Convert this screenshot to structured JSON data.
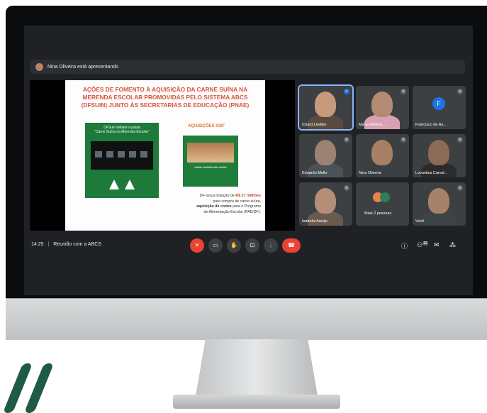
{
  "meeting": {
    "presenting_text": "Nina Oliveira está apresentando",
    "time": "14:25",
    "separator": "|",
    "title": "Reunião com a ABCS"
  },
  "slide": {
    "title_line1": "AÇÕES DE FOMENTO À AQUISIÇÃO DA CARNE SUÍNA NA",
    "title_line2": "MERENDA ESCOLAR PROMOVIDAS PELO SISTEMA ABCS",
    "title_line3": "(DFSUIN) JUNTO ÀS SECRETARIAS DE EDUCAÇÃO (PNAE)",
    "promo_caption_1": "DFSuin debate a pauta",
    "promo_caption_2": "“Carne Suína na Merenda Escolar”",
    "acq_title": "AQUISIÇÕES GDF",
    "text_1": "DF lança licitação de",
    "text_amount": "R$ 27 milhões",
    "text_2": "para compra de carne suína,",
    "text_bold": "aquisição de cortes",
    "text_3": "para o Programa",
    "text_4": "de Alimentação Escolar (PAE/DF)."
  },
  "participants": [
    {
      "name": "Ichard Liedtke",
      "speaking": true
    },
    {
      "name": "Maria Antônia ...",
      "speaking": false
    },
    {
      "name": "Francisco de As...",
      "initial": "F"
    },
    {
      "name": "Eduardo Mello",
      "speaking": false
    },
    {
      "name": "Nina Oliveira",
      "speaking": false
    },
    {
      "name": "Lovanilza Carval...",
      "speaking": false
    },
    {
      "name": "Isabella Araújo",
      "speaking": false
    },
    {
      "name": "Mais 2 pessoas",
      "speaking": false
    },
    {
      "name": "Você",
      "speaking": false
    }
  ],
  "controls": {
    "mic": "mic-off-icon",
    "camera": "camera-icon",
    "hand": "raise-hand-icon",
    "present": "present-icon",
    "more": "more-options-icon",
    "hangup": "hang-up-icon",
    "participants_count": "13"
  },
  "colors": {
    "slide_title": "#d9533b",
    "promo_green": "#1d7a3a",
    "hangup_red": "#ea4335",
    "meet_bg": "#202124",
    "speaking_outline": "#8ab4f8"
  }
}
